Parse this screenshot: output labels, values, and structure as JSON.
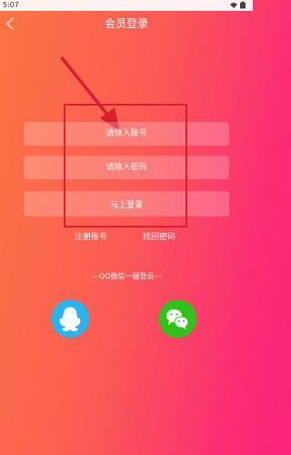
{
  "status_bar": {
    "time": "5:07"
  },
  "header": {
    "title": "会员登录"
  },
  "form": {
    "account_placeholder": "请输入账号",
    "password_placeholder": "请输入密码",
    "login_label": "马上登录"
  },
  "links": {
    "register": "注册账号",
    "forgot_password": "找回密码"
  },
  "social": {
    "divider": "---QQ微信一键登录---",
    "qq_icon": "qq-penguin-icon",
    "wechat_icon": "wechat-icon",
    "qq_color": "#2ab4ee",
    "wechat_color": "#33c21c"
  },
  "colors": {
    "gradient_start": "#fb7543",
    "gradient_end": "#fa2378",
    "highlight_box": "#d71f2f"
  }
}
